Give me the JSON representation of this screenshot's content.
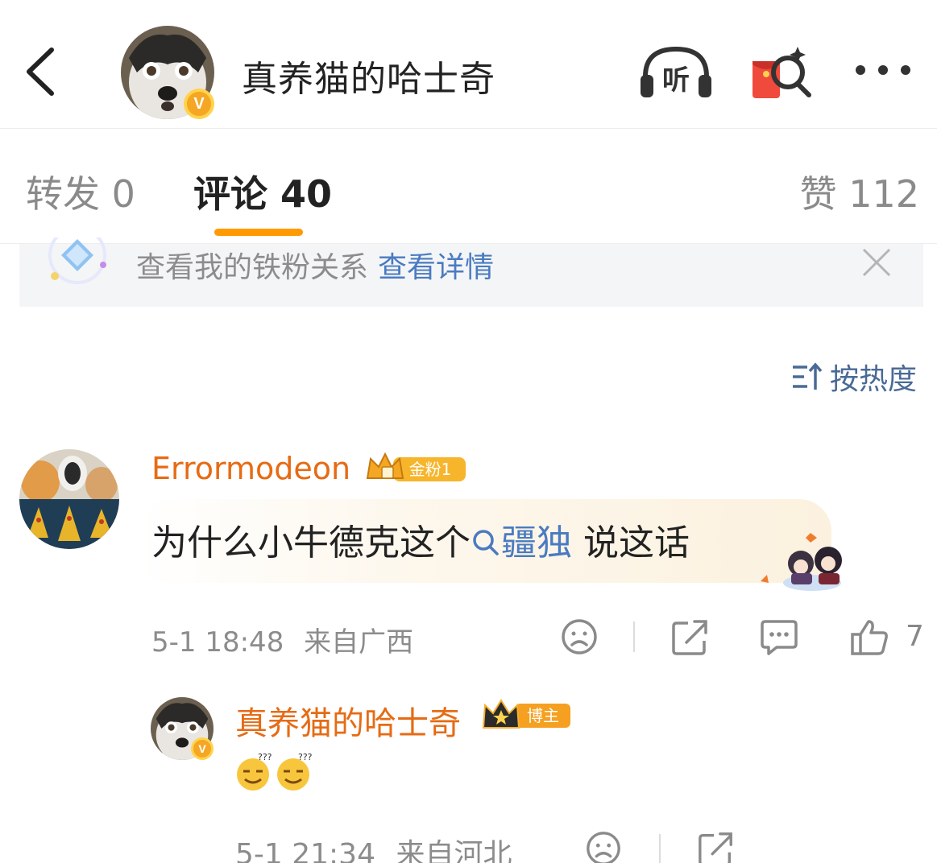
{
  "header": {
    "title": "真养猫的哈士奇",
    "verified_badge": "V",
    "listen_label": "听"
  },
  "tabs": {
    "repost": "转发 0",
    "comment": "评论 40",
    "like": "赞 112"
  },
  "fan_banner": {
    "text": "查看我的铁粉关系",
    "link": "查看详情"
  },
  "sort": {
    "label": "按热度"
  },
  "comment": {
    "username": "Errormodeon",
    "fan_badge": "金粉1",
    "text_before": "为什么小牛德克这个",
    "topic": "疆独",
    "text_after": " 说这话",
    "time": "5-1 18:48",
    "location": "来自广西",
    "like_count": "7"
  },
  "reply": {
    "username": "真养猫的哈士奇",
    "author_badge": "博主",
    "time": "5-1 21:34",
    "location": "来自河北"
  },
  "colors": {
    "accent_orange": "#ff9a00",
    "username_orange": "#e66b14",
    "link_blue": "#4a7bc1",
    "muted": "#8c8c8c"
  },
  "icons": [
    "back-arrow-icon",
    "headphones-icon",
    "red-envelope-icon",
    "more-dots-icon",
    "diamond-icon",
    "close-icon",
    "sort-icon",
    "search-icon",
    "sad-face-icon",
    "share-icon",
    "comment-icon",
    "thumbs-up-icon",
    "doubtful-emoji-icon"
  ]
}
